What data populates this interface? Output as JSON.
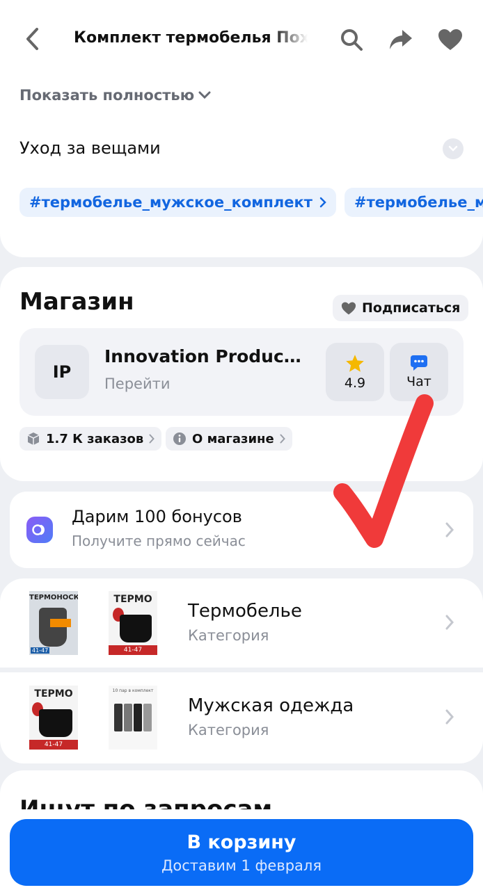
{
  "header": {
    "title": "Комплект термобелья Похо",
    "icons": [
      "back-arrow-icon",
      "search-icon",
      "share-icon",
      "heart-icon"
    ]
  },
  "description": {
    "show_more": "Показать полностью",
    "care_label": "Уход за вещами",
    "tags": [
      "#термобелье_мужское_комплект",
      "#термобелье_м"
    ]
  },
  "store": {
    "heading": "Магазин",
    "subscribe": "Подписаться",
    "initials": "IP",
    "name": "Innovation Product…",
    "go": "Перейти",
    "rating": "4.9",
    "chat": "Чат",
    "orders": "1.7 К заказов",
    "about": "О магазине"
  },
  "bonus": {
    "title": "Дарим 100 бонусов",
    "subtitle": "Получите прямо сейчас"
  },
  "categories": [
    {
      "title": "Термобелье",
      "subtitle": "Категория",
      "thumb1": "ТЕРМОНОСКИ",
      "thumb2": "ТЕРМО",
      "size": "41-47"
    },
    {
      "title": "Мужская одежда",
      "subtitle": "Категория",
      "thumb1": "ТЕРМО",
      "thumb2": "10 пар в комплект",
      "size": "41-47"
    }
  ],
  "partial_heading": "Ищут по запросам",
  "footer": {
    "button": "В корзину",
    "delivery": "Доставим 1 февраля"
  },
  "colors": {
    "accent": "#0A6CF6",
    "tag_text": "#1266E0",
    "star": "#F5B800",
    "chat": "#1E6FF2",
    "checkmark": "#F03A3A"
  }
}
